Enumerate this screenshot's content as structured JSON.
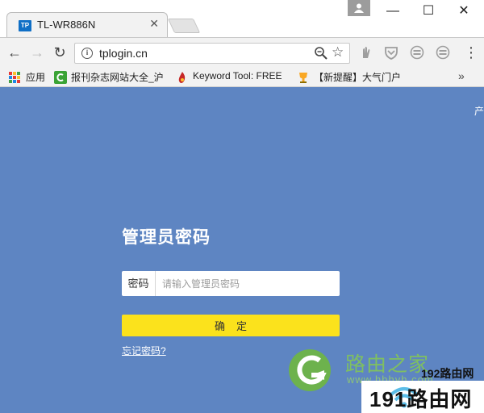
{
  "browser": {
    "tab": {
      "favicon_text": "TP",
      "title": "TL-WR886N",
      "close": "✕"
    },
    "window_controls": {
      "minimize": "—",
      "maximize": "☐",
      "close": "✕"
    },
    "nav": {
      "back": "←",
      "forward": "→",
      "reload": "↻"
    },
    "address_bar": {
      "url": "tplogin.cn"
    },
    "menu": "⋮"
  },
  "bookmarks": {
    "apps_label": "应用",
    "items": [
      {
        "label": "报刊杂志网站大全_沪",
        "icon": "green-c-icon"
      },
      {
        "label": "Keyword Tool: FREE",
        "icon": "flame-icon"
      },
      {
        "label": "【新提醒】大气门户",
        "icon": "trophy-icon"
      }
    ],
    "more": "»"
  },
  "page": {
    "corner_text": "产",
    "title": "管理员密码",
    "password": {
      "label": "密码",
      "placeholder": "请输入管理员密码",
      "value": ""
    },
    "confirm_label": "确定",
    "forgot_link": "忘记密码?"
  },
  "watermark": {
    "brand_cn": "路由之家",
    "brand_url": "www.hbhyh.com",
    "site_small": "192路由网",
    "site_big": "191路由网"
  },
  "colors": {
    "page_background": "#5e85c2",
    "confirm_button": "#fbe21c",
    "favicon": "#0f6fc6",
    "watermark_green": "#7fbf62"
  }
}
